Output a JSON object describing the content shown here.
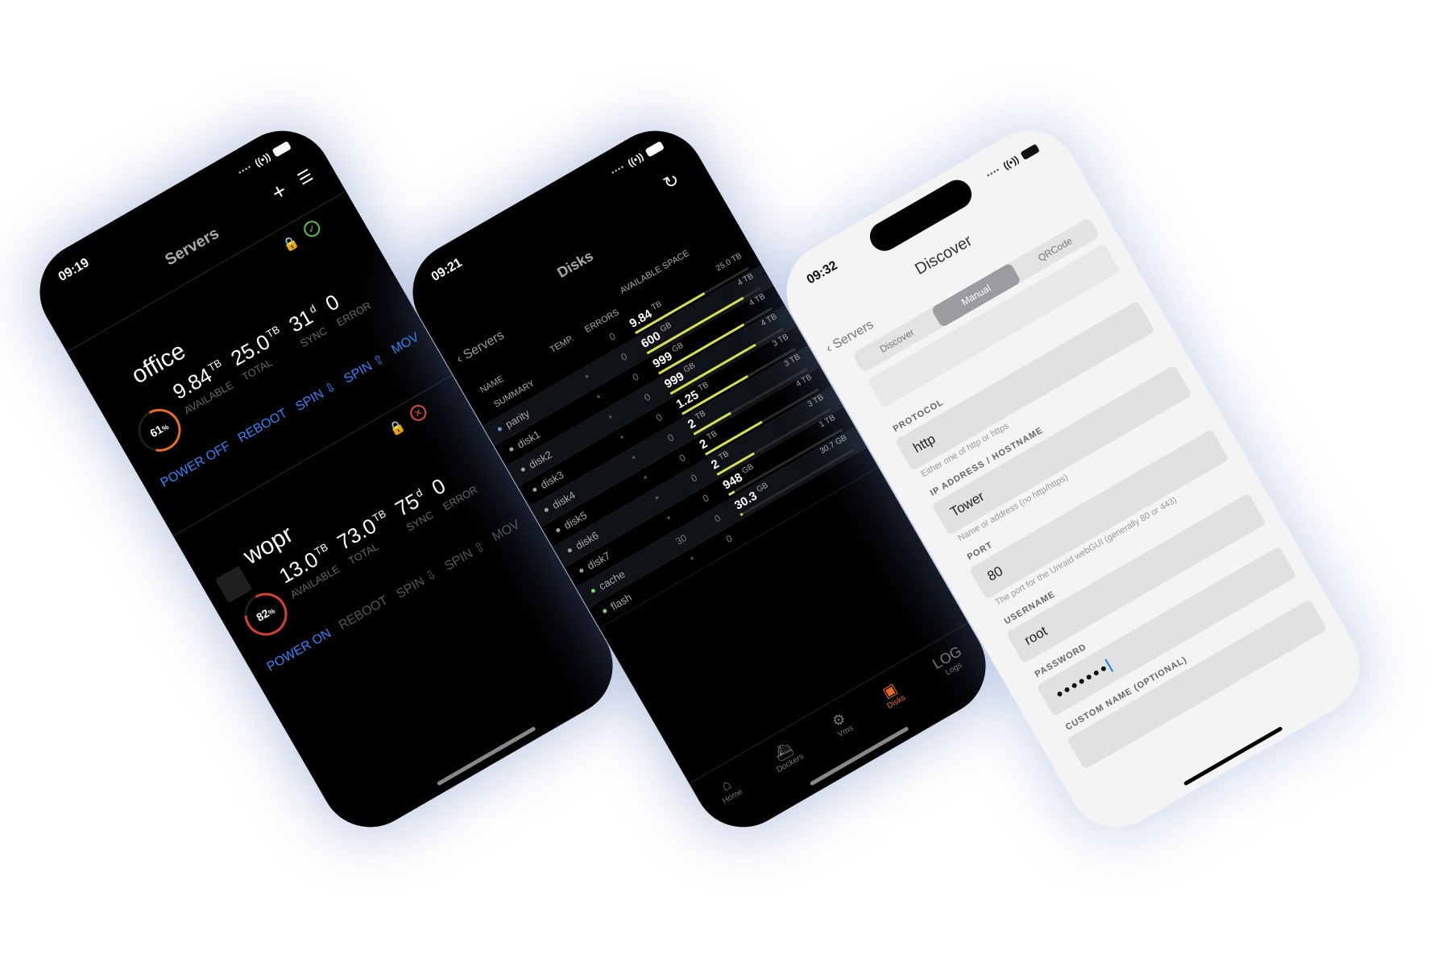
{
  "phones": [
    {
      "time": "09:19",
      "title": "Servers",
      "servers": [
        {
          "name": "office",
          "usage_percent": "61",
          "usage_suffix": "%",
          "available": "9.84",
          "available_unit": "TB",
          "available_label": "AVAILABLE",
          "total": "25.0",
          "total_unit": "TB",
          "total_label": "TOTAL",
          "sync": "31",
          "sync_unit": "d",
          "sync_label": "SYNC",
          "error": "0",
          "error_label": "ERROR",
          "status": "ok",
          "actions": [
            "POWER OFF",
            "REBOOT",
            "SPIN ⇩",
            "SPIN ⇧",
            "MOV"
          ]
        },
        {
          "name": "wopr",
          "usage_percent": "82",
          "usage_suffix": "%",
          "available": "13.0",
          "available_unit": "TB",
          "available_label": "AVAILABLE",
          "total": "73.0",
          "total_unit": "TB",
          "total_label": "TOTAL",
          "sync": "75",
          "sync_unit": "d",
          "sync_label": "SYNC",
          "error": "0",
          "error_label": "ERROR",
          "status": "error",
          "actions": [
            "POWER ON",
            "REBOOT",
            "SPIN ⇩",
            "SPIN ⇧",
            "MOV"
          ]
        }
      ]
    },
    {
      "time": "09:21",
      "title": "Disks",
      "back_label": "Servers",
      "headers": {
        "name": "NAME",
        "temp": "TEMP.",
        "errors": "ERRORS",
        "space": "AVAILABLE SPACE"
      },
      "disks": [
        {
          "name": "SUMMARY",
          "temp": "",
          "errors": "0",
          "free": "9.84",
          "free_unit": "TB",
          "total": "25.0 TB",
          "used_fraction": 0.61,
          "dot": ""
        },
        {
          "name": "parity",
          "temp": "*",
          "errors": "0",
          "free": "600",
          "free_unit": "GB",
          "total": "4 TB",
          "used_fraction": 0.85,
          "dot": "#6b8fd6"
        },
        {
          "name": "disk1",
          "temp": "*",
          "errors": "0",
          "free": "999",
          "free_unit": "GB",
          "total": "4 TB",
          "used_fraction": 0.75,
          "dot": "#9aa0a6"
        },
        {
          "name": "disk2",
          "temp": "*",
          "errors": "0",
          "free": "999",
          "free_unit": "GB",
          "total": "4 TB",
          "used_fraction": 0.75,
          "dot": "#9aa0a6"
        },
        {
          "name": "disk3",
          "temp": "*",
          "errors": "0",
          "free": "1.25",
          "free_unit": "TB",
          "total": "3 TB",
          "used_fraction": 0.58,
          "dot": "#9aa0a6"
        },
        {
          "name": "disk4",
          "temp": "*",
          "errors": "0",
          "free": "2",
          "free_unit": "TB",
          "total": "3 TB",
          "used_fraction": 0.33,
          "dot": "#9aa0a6"
        },
        {
          "name": "disk5",
          "temp": "*",
          "errors": "0",
          "free": "2",
          "free_unit": "TB",
          "total": "4 TB",
          "used_fraction": 0.5,
          "dot": "#9aa0a6"
        },
        {
          "name": "disk6",
          "temp": "*",
          "errors": "0",
          "free": "2",
          "free_unit": "TB",
          "total": "3 TB",
          "used_fraction": 0.33,
          "dot": "#9aa0a6"
        },
        {
          "name": "disk7",
          "temp": "*",
          "errors": "0",
          "free": "948",
          "free_unit": "GB",
          "total": "1 TB",
          "used_fraction": 0.05,
          "dot": "#9aa0a6"
        },
        {
          "name": "cache",
          "temp": "30",
          "errors": "0",
          "free": "30.3",
          "free_unit": "GB",
          "total": "30.7 GB",
          "used_fraction": 0.02,
          "dot": "#7dd36b"
        },
        {
          "name": "flash",
          "temp": "*",
          "errors": "0",
          "free": "",
          "free_unit": "",
          "total": "",
          "used_fraction": 0,
          "dot": "#7dd36b"
        }
      ],
      "tabs": [
        {
          "label": "Home",
          "icon": "home-icon",
          "glyph": "⌂"
        },
        {
          "label": "Dockers",
          "icon": "docker-icon",
          "glyph": "⛴"
        },
        {
          "label": "Vms",
          "icon": "vm-gear-icon",
          "glyph": "⚙"
        },
        {
          "label": "Disks",
          "icon": "disks-icon",
          "glyph": "▣"
        },
        {
          "label": "Logs",
          "icon": "log-icon",
          "glyph": "LOG"
        }
      ],
      "active_tab": "Disks"
    },
    {
      "time": "09:32",
      "title": "Discover",
      "back_label": "Servers",
      "segments": [
        "Discover",
        "Manual",
        "QRCode"
      ],
      "active_segment": "Manual",
      "fields": [
        {
          "label": "PROTOCOL",
          "value": "http",
          "help": "Either one of http or https"
        },
        {
          "label": "IP ADDRESS / HOSTNAME",
          "value": "Tower",
          "help": "Name or address (no http/https)"
        },
        {
          "label": "PORT",
          "value": "80",
          "help": "The port for the Unraid webGUI (generally 80 or 443)"
        },
        {
          "label": "USERNAME",
          "value": "root",
          "help": ""
        },
        {
          "label": "PASSWORD",
          "value": "●●●●●●●",
          "help": ""
        },
        {
          "label": "CUSTOM NAME (OPTIONAL)",
          "value": "",
          "help": ""
        }
      ]
    }
  ],
  "colors": {
    "accent_blue": "#2f86ff",
    "bar_yellow": "#d7e04a",
    "ok_green": "#5ec24d",
    "error_red": "#e2463c",
    "gauge_orange": "#e86a24",
    "gauge_red": "#d4412e"
  }
}
